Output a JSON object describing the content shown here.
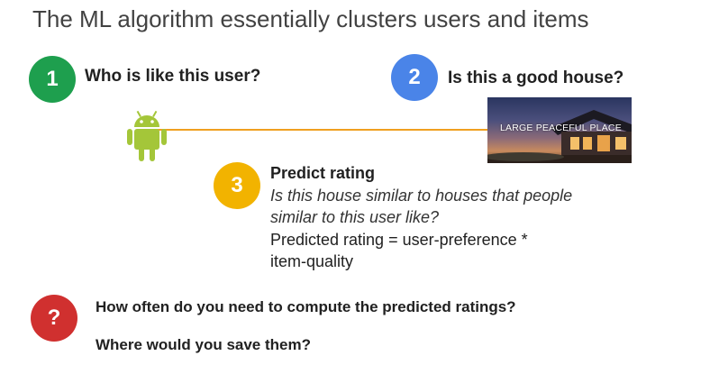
{
  "title": "The ML algorithm essentially clusters users and items",
  "step1": {
    "badge": "1",
    "text": "Who is like this user?",
    "color": "#1e9f4e"
  },
  "step2": {
    "badge": "2",
    "text": "Is this a good house?",
    "color": "#4a84e8",
    "image_caption": "LARGE PEACEFUL PLACE"
  },
  "step3": {
    "badge": "3",
    "color": "#f2b300",
    "title": "Predict rating",
    "question_line1": "Is this house similar to houses that people",
    "question_line2": "similar to this user like?",
    "formula_line1": "Predicted rating = user-preference *",
    "formula_line2": "item-quality"
  },
  "question": {
    "badge": "?",
    "color": "#d0302f",
    "line1": "How often do you need to compute the predicted ratings?",
    "line2": "Where would you save them?"
  },
  "icons": {
    "user": "android-icon",
    "item": "house-image"
  },
  "connector_color": "#f0a020"
}
